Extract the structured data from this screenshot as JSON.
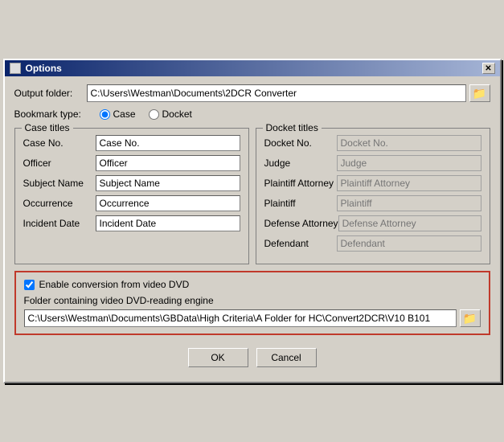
{
  "window": {
    "title": "Options",
    "close_label": "✕"
  },
  "output_folder": {
    "label": "Output folder:",
    "value": "C:\\Users\\Westman\\Documents\\2DCR Converter",
    "browse_icon": "📁"
  },
  "bookmark_type": {
    "label": "Bookmark type:",
    "options": [
      "Case",
      "Docket"
    ],
    "selected": "Case"
  },
  "case_titles": {
    "group_label": "Case titles",
    "fields": [
      {
        "label": "Case No.",
        "value": "Case No."
      },
      {
        "label": "Officer",
        "value": "Officer"
      },
      {
        "label": "Subject Name",
        "value": "Subject Name"
      },
      {
        "label": "Occurrence",
        "value": "Occurrence"
      },
      {
        "label": "Incident Date",
        "value": "Incident Date"
      }
    ]
  },
  "docket_titles": {
    "group_label": "Docket titles",
    "fields": [
      {
        "label": "Docket No.",
        "placeholder": "Docket No."
      },
      {
        "label": "Judge",
        "placeholder": "Judge"
      },
      {
        "label": "Plaintiff Attorney",
        "placeholder": "Plaintiff Attorney"
      },
      {
        "label": "Plaintiff",
        "placeholder": "Plaintiff"
      },
      {
        "label": "Defense Attorney",
        "placeholder": "Defense Attorney"
      },
      {
        "label": "Defendant",
        "placeholder": "Defendant"
      }
    ]
  },
  "video_section": {
    "checkbox_label": "Enable conversion from video DVD",
    "folder_label": "Folder containing video DVD-reading engine",
    "folder_value": "C:\\Users\\Westman\\Documents\\GBData\\High Criteria\\A Folder for HC\\Convert2DCR\\V10 B101",
    "browse_icon": "📁"
  },
  "buttons": {
    "ok": "OK",
    "cancel": "Cancel"
  }
}
